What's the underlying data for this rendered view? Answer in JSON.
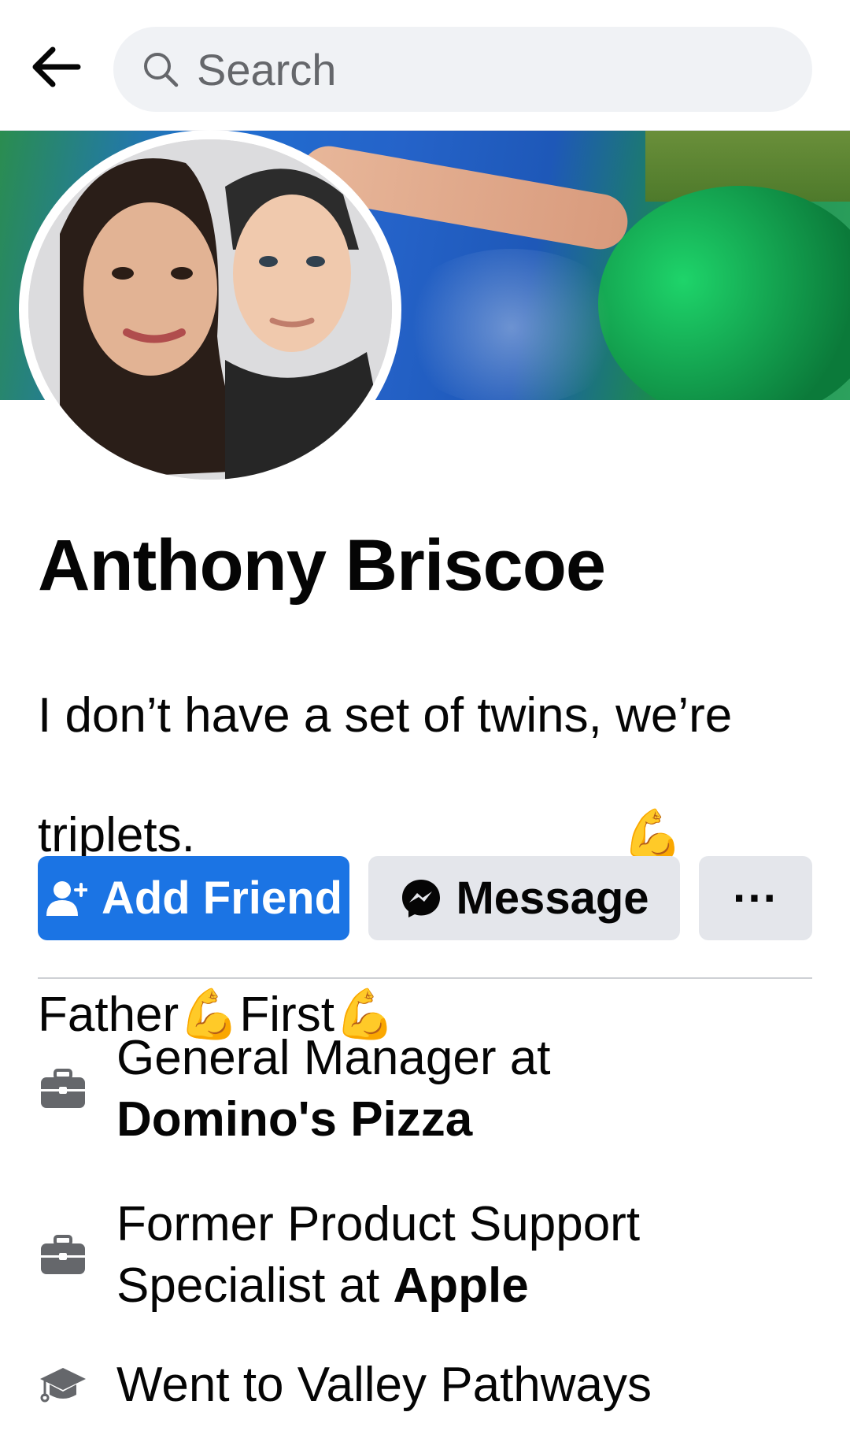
{
  "header": {
    "search_placeholder": "Search",
    "back_icon": "arrow-left-icon",
    "search_icon": "search-icon"
  },
  "profile": {
    "name": "Anthony Briscoe",
    "bio_line1": "I don’t have a set of twins, we’re",
    "bio_line2": "triplets.",
    "bio_emoji_1": "💪",
    "bio_line3_a": "Father",
    "bio_emoji_2": "💪",
    "bio_line3_b": "First",
    "bio_emoji_3": "💪"
  },
  "actions": {
    "add_friend": "Add Friend",
    "message": "Message",
    "more": "···"
  },
  "info": [
    {
      "icon": "briefcase-icon",
      "prefix": "General  Manager at",
      "bold": "Domino's Pizza"
    },
    {
      "icon": "briefcase-icon",
      "prefix": "Former Product Support Specialist at ",
      "bold": "Apple"
    },
    {
      "icon": "graduation-cap-icon",
      "prefix": "Went to Valley Pathways",
      "bold": ""
    }
  ],
  "colors": {
    "primary": "#1b74e4",
    "secondary_button": "#e4e6eb",
    "search_bg": "#f0f2f5",
    "icon_gray": "#65676b"
  }
}
